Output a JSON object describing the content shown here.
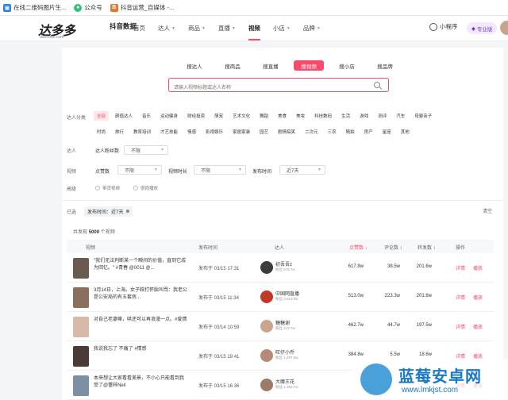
{
  "bookmarks": [
    {
      "label": "在线二维码图片生...",
      "icon": "qr-icon",
      "color": "#2a82e4"
    },
    {
      "label": "公众号",
      "icon": "wechat-icon",
      "color": "#31c27c"
    },
    {
      "label": "抖音运营_自媒体 -...",
      "icon": "b-icon",
      "color": "#e8772e"
    }
  ],
  "logo": {
    "main": "达多多",
    "cn": "抖音数据",
    "sub": "dadoduo.com"
  },
  "nav": {
    "items": [
      {
        "label": "首页",
        "caret": false
      },
      {
        "label": "达人",
        "caret": true
      },
      {
        "label": "商品",
        "caret": true
      },
      {
        "label": "直播",
        "caret": true
      },
      {
        "label": "视频",
        "caret": false
      },
      {
        "label": "小店",
        "caret": true
      },
      {
        "label": "品牌",
        "caret": true
      }
    ],
    "active": "视频",
    "mini_program": "小程序",
    "pro": "专业版"
  },
  "search": {
    "tabs": [
      "搜达人",
      "搜商品",
      "搜直播",
      "搜视频",
      "搜小店",
      "搜品牌"
    ],
    "active": "搜视频",
    "placeholder": "请输入视频标题或达人名称"
  },
  "filters": {
    "category_label": "达人分类",
    "categories_row1": [
      "全部",
      "颜值达人",
      "音乐",
      "运动健身",
      "财经投资",
      "萌宠",
      "艺术文化",
      "舞蹈",
      "美食",
      "美妆",
      "科技数码",
      "生活",
      "游戏",
      "测评",
      "汽车",
      "母婴亲子"
    ],
    "categories_row2": [
      "时尚",
      "旅行",
      "教育培训",
      "才艺技能",
      "情感",
      "影视娱乐",
      "家居家装",
      "园艺",
      "剧情搞笑",
      "二次元",
      "三农",
      "随拍",
      "房产",
      "星座",
      "其他"
    ],
    "active_category": "全部",
    "fans_group": "达人",
    "fans_label": "达人粉丝数",
    "fans_value": "不限",
    "video_group": "视频",
    "likes_label": "点赞数",
    "likes_value": "不限",
    "duration_label": "视频时长",
    "duration_value": "不限",
    "pubtime_label": "发布时间",
    "pubtime_value": "近7天",
    "advanced_group": "高级",
    "opt1": "带货视频",
    "opt2": "很抱播放",
    "selected_label": "已选",
    "selected_tag": "发布时间：近7天",
    "clear": "清空"
  },
  "table": {
    "total_prefix": "共发现",
    "total_count": "5000",
    "total_suffix": "个视频",
    "headers": {
      "video": "视频",
      "time": "发布时间",
      "author": "达人",
      "likes": "点赞数",
      "comments": "评论数",
      "shares": "转发数",
      "ops": "操作"
    },
    "rows": [
      {
        "title": "\"我们无法判断某一个瞬间的价值，直到它成为回忆。\" #青春 @0011 @...",
        "time": "发布于 03/15 17:31",
        "author": "初吾吾z",
        "fans": "粉丝 578.7w",
        "likes": "617.8w",
        "comments": "38.5w",
        "shares": "201.6w",
        "thumb": "#6b5a4f",
        "avatar": "#3b3b3b"
      },
      {
        "title": "3月14日，上海。女子踩打怀胎叫骂：我老公是公安局的有五套房...",
        "time": "发布于 03/15 11:34",
        "author": "中国网直播",
        "fans": "粉丝 3,013.9w",
        "likes": "513.0w",
        "comments": "223.3w",
        "shares": "201.6w",
        "thumb": "#8a6f5c",
        "avatar": "#c0392b"
      },
      {
        "title": "对自己老婆嘛，哄还可以再浪漫一点。#爱情",
        "time": "发布于 03/14 10:59",
        "author": "糖糖谢",
        "fans": "粉丝 213.7w",
        "likes": "462.7w",
        "comments": "44.7w",
        "shares": "197.5w",
        "thumb": "#d8b9a8",
        "avatar": "#caa48c"
      },
      {
        "title": "我说我忘了 不痛了 #情感",
        "time": "发布于 03/15 19:41",
        "author": "旺仔小乔",
        "fans": "粉丝 1,497.5w",
        "likes": "384.8w",
        "comments": "5.5w",
        "shares": "18.6w",
        "thumb": "#4a3b36",
        "avatar": "#b48a78"
      },
      {
        "title": "本来想让大家看看美景，不小心只能看到我受了@蕾梓Neil",
        "time": "发布于 03/15 16:36",
        "author": "大魔王花",
        "fans": "粉丝 1,352.7w",
        "likes": "",
        "comments": "",
        "shares": "",
        "thumb": "#7c8fa3",
        "avatar": "#9a7a6a"
      }
    ],
    "op_detail": "详情",
    "op_play": "播放"
  },
  "watermark": {
    "title": "蓝莓安卓网",
    "url": "www.lmkjst.com"
  }
}
